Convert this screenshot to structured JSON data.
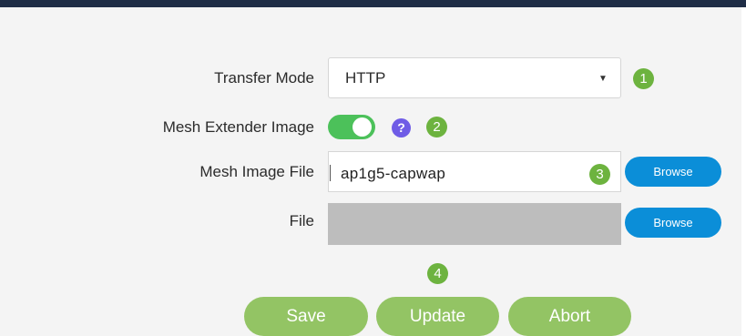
{
  "form": {
    "transfer_mode": {
      "label": "Transfer Mode",
      "value": "HTTP",
      "arrow_glyph": "▼"
    },
    "mesh_extender_image": {
      "label": "Mesh Extender Image",
      "toggle_on": true,
      "help_glyph": "?"
    },
    "mesh_image_file": {
      "label": "Mesh Image File",
      "value": "ap1g5-capwap",
      "browse_label": "Browse"
    },
    "file": {
      "label": "File",
      "value": "",
      "browse_label": "Browse"
    }
  },
  "callouts": [
    "1",
    "2",
    "3",
    "4"
  ],
  "actions": {
    "save_label": "Save",
    "update_label": "Update",
    "abort_label": "Abort"
  },
  "colors": {
    "header": "#1f2d46",
    "badge": "#6db33f",
    "toggle_on": "#4cc15a",
    "help_icon": "#6f5ce6",
    "browse": "#0b8ed8",
    "action_button": "#93c464",
    "file_disabled": "#bdbdbd"
  },
  "icons": {
    "dropdown": "caret-down-icon",
    "help": "question-circle-icon"
  }
}
